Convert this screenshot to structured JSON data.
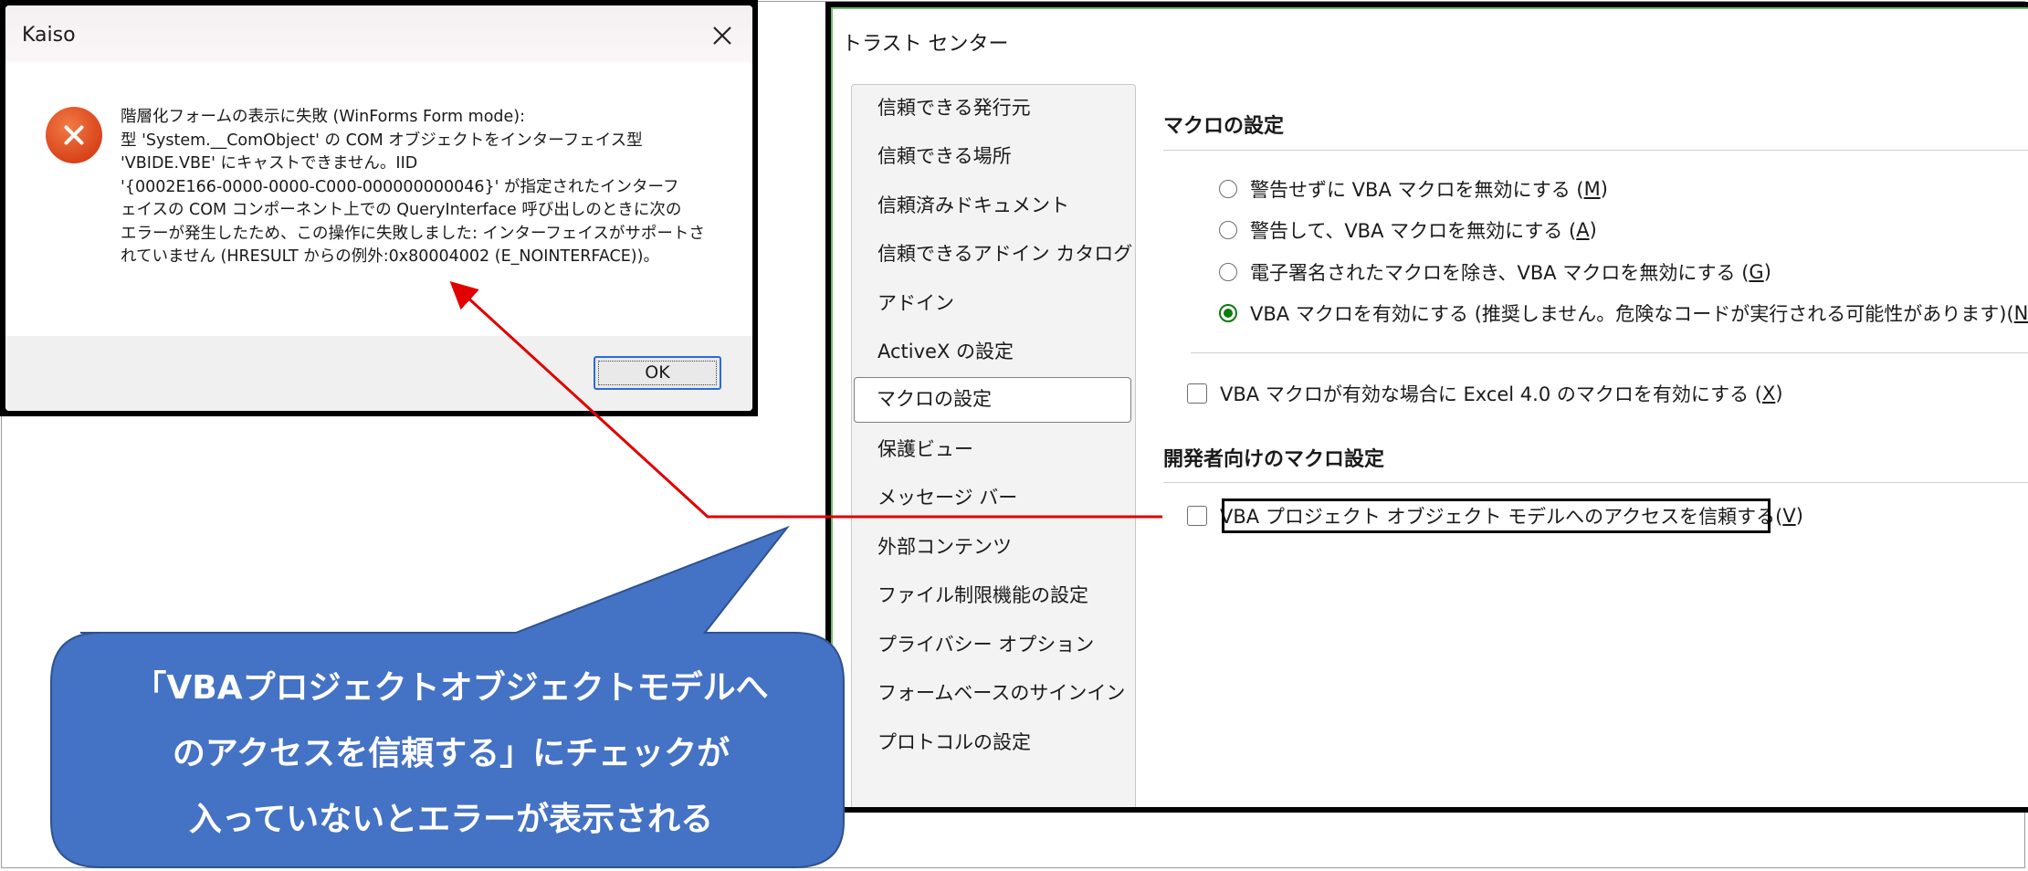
{
  "error_dialog": {
    "title": "Kaiso",
    "close_glyph": "✕",
    "icon": "error-icon",
    "message_lines": [
      "階層化フォームの表示に失敗 (WinForms Form mode):",
      "型 'System.__ComObject' の COM オブジェクトをインターフェイス型",
      "'VBIDE.VBE' にキャストできません。IID",
      "'{0002E166-0000-0000-C000-000000000046}' が指定されたインターフ",
      "ェイスの COM コンポーネント上での QueryInterface 呼び出しのときに次の",
      "エラーが発生したため、この操作に失敗しました: インターフェイスがサポートさ",
      "れていません (HRESULT からの例外:0x80004002 (E_NOINTERFACE))。"
    ],
    "ok_label": "OK"
  },
  "trust_center": {
    "title": "トラスト センター",
    "nav_items": [
      "信頼できる発行元",
      "信頼できる場所",
      "信頼済みドキュメント",
      "信頼できるアドイン カタログ",
      "アドイン",
      "ActiveX の設定",
      "マクロの設定",
      "保護ビュー",
      "メッセージ バー",
      "外部コンテンツ",
      "ファイル制限機能の設定",
      "プライバシー オプション",
      "フォームベースのサインイン",
      "プロトコルの設定"
    ],
    "selected_nav": "マクロの設定",
    "macro_settings": {
      "heading": "マクロの設定",
      "options": [
        {
          "text": "警告せずに VBA マクロを無効にする (",
          "key": "M",
          "close": ")",
          "checked": false
        },
        {
          "text": "警告して、VBA マクロを無効にする (",
          "key": "A",
          "close": ")",
          "checked": false
        },
        {
          "text": "電子署名されたマクロを除き、VBA マクロを無効にする (",
          "key": "G",
          "close": ")",
          "checked": false
        },
        {
          "text": "VBA マクロを有効にする (推奨しません。危険なコードが実行される可能性があります)(",
          "key": "N",
          "close": ")",
          "checked": true
        }
      ],
      "excel4_checkbox": {
        "text": "VBA マクロが有効な場合に Excel 4.0 のマクロを有効にする (",
        "key": "X",
        "close": ")",
        "checked": false
      }
    },
    "developer_settings": {
      "heading": "開発者向けのマクロ設定",
      "trust_vba_checkbox": {
        "text": "VBA プロジェクト オブジェクト モデルへのアクセスを信頼する(",
        "key": "V",
        "close": ")",
        "checked": false
      }
    }
  },
  "callout": {
    "lines": [
      "「VBAプロジェクトオブジェクトモデルへ",
      "のアクセスを信頼する」にチェックが",
      "入っていないとエラーが表示される"
    ],
    "fill_color": "#4472c4",
    "arrow_color": "#e00000"
  }
}
